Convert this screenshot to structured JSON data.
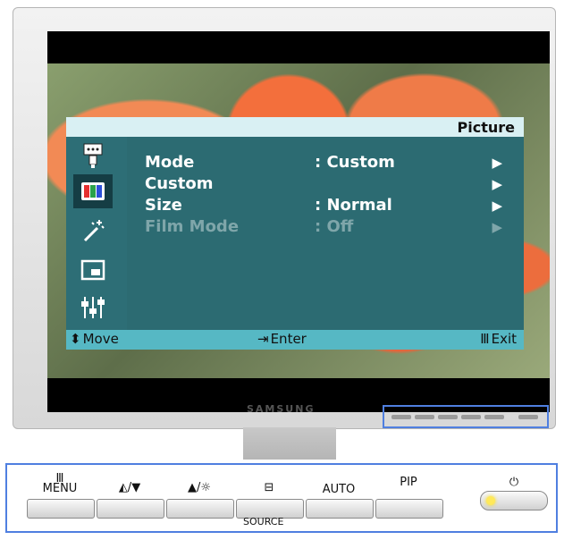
{
  "osd": {
    "title": "Picture",
    "items": [
      {
        "label": "Mode",
        "value": ": Custom",
        "arrow": "▶"
      },
      {
        "label": "Custom",
        "value": "",
        "arrow": "▶"
      },
      {
        "label": "Size",
        "value": ": Normal",
        "arrow": "▶"
      },
      {
        "label": "Film Mode",
        "value": ": Off",
        "arrow": "▶"
      }
    ],
    "footer": {
      "move": "Move",
      "enter": "Enter",
      "exit": "Exit"
    }
  },
  "monitor": {
    "brand": "SAMSUNG"
  },
  "panel": {
    "menu_label": "MENU",
    "auto_label": "AUTO",
    "pip_label": "PIP",
    "source_label": "SOURCE"
  }
}
